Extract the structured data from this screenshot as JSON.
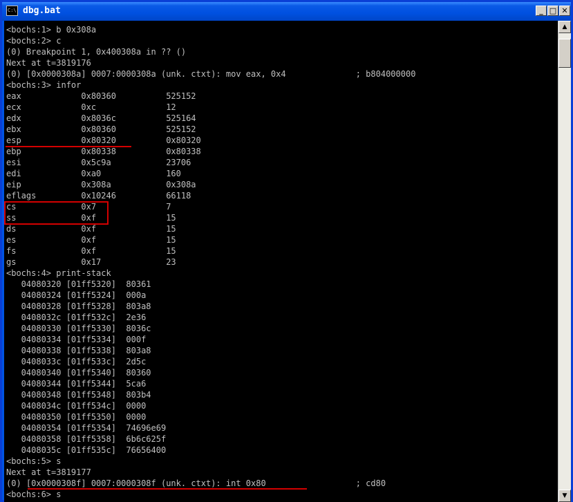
{
  "window": {
    "title": "dbg.bat",
    "icon_text": "C:\\",
    "minimize_icon": "_",
    "maximize_icon": "□",
    "close_icon": "✕",
    "scroll_up_icon": "▲",
    "scroll_down_icon": "▼",
    "annotation_color": "#d40000"
  },
  "console": {
    "lines": [
      "<bochs:1> b 0x308a",
      "<bochs:2> c",
      "(0) Breakpoint 1, 0x400308a in ?? ()",
      "Next at t=3819176",
      "(0) [0x0000308a] 0007:0000308a (unk. ctxt): mov eax, 0x4              ; b804000000",
      "<bochs:3> infor",
      "eax            0x80360          525152",
      "ecx            0xc              12",
      "edx            0x8036c          525164",
      "ebx            0x80360          525152",
      "esp            0x80320          0x80320",
      "ebp            0x80338          0x80338",
      "esi            0x5c9a           23706",
      "edi            0xa0             160",
      "eip            0x308a           0x308a",
      "eflags         0x10246          66118",
      "cs             0x7              7",
      "ss             0xf              15",
      "ds             0xf              15",
      "es             0xf              15",
      "fs             0xf              15",
      "gs             0x17             23",
      "<bochs:4> print-stack",
      "   04080320 [01ff5320]  80361",
      "   04080324 [01ff5324]  000a",
      "   04080328 [01ff5328]  803a8",
      "   0408032c [01ff532c]  2e36",
      "   04080330 [01ff5330]  8036c",
      "   04080334 [01ff5334]  000f",
      "   04080338 [01ff5338]  803a8",
      "   0408033c [01ff533c]  2d5c",
      "   04080340 [01ff5340]  80360",
      "   04080344 [01ff5344]  5ca6",
      "   04080348 [01ff5348]  803b4",
      "   0408034c [01ff534c]  0000",
      "   04080350 [01ff5350]  0000",
      "   04080354 [01ff5354]  74696e69",
      "   04080358 [01ff5358]  6b6c625f",
      "   0408035c [01ff535c]  76656400",
      "<bochs:5> s",
      "Next at t=3819177",
      "(0) [0x0000308f] 0007:0000308f (unk. ctxt): int 0x80                  ; cd80",
      "<bochs:6> s"
    ]
  }
}
